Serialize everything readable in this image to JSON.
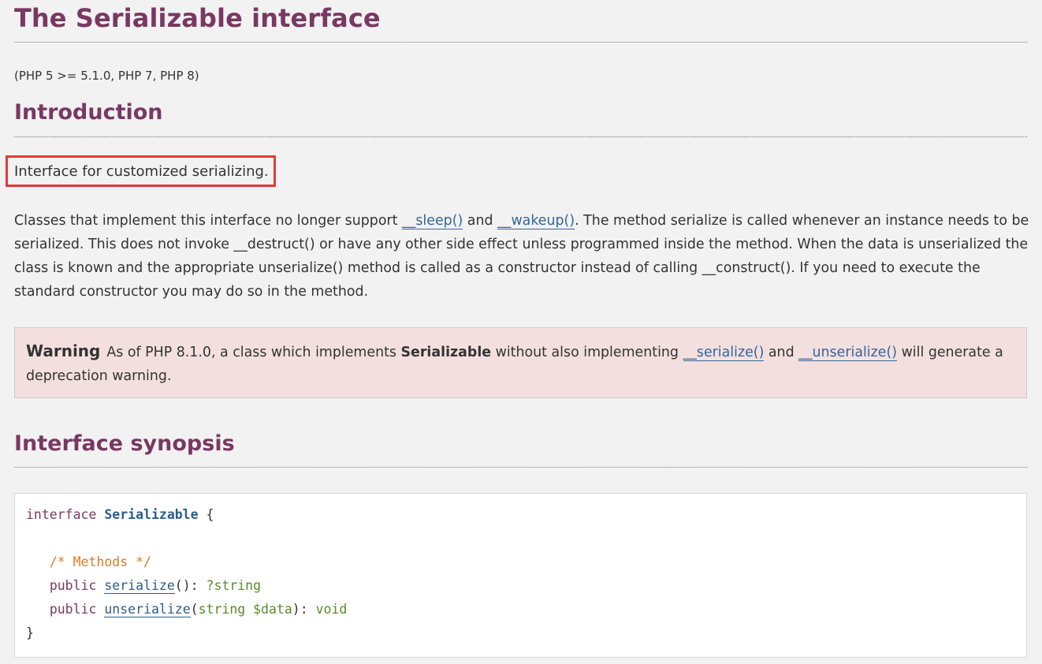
{
  "page": {
    "title": "The Serializable interface",
    "version": "(PHP 5 >= 5.1.0, PHP 7, PHP 8)"
  },
  "introduction": {
    "heading": "Introduction",
    "summary": "Interface for customized serializing.",
    "para_part1": "Classes that implement this interface no longer support ",
    "link_sleep": "__sleep()",
    "para_and": " and ",
    "link_wakeup": "__wakeup()",
    "para_part2": ". The method serialize is called whenever an instance needs to be serialized. This does not invoke __destruct() or have any other side effect unless programmed inside the method. When the data is unserialized the class is known and the appropriate unserialize() method is called as a constructor instead of calling __construct(). If you need to execute the standard constructor you may do so in the method."
  },
  "warning": {
    "title": "Warning",
    "text_part1": "As of PHP 8.1.0, a class which implements ",
    "bold": "Serializable",
    "text_part2": " without also implementing ",
    "link_serialize": "__serialize()",
    "text_and": " and ",
    "link_unserialize": "__unserialize()",
    "text_part3": " will generate a deprecation warning."
  },
  "synopsis": {
    "heading": "Interface synopsis",
    "kw_interface": "interface",
    "class_name": "Serializable",
    "open_brace": "{",
    "comment": "/* Methods */",
    "kw_public": "public",
    "method_serialize": "serialize",
    "serialize_sig": "(): ",
    "serialize_return": "?string",
    "method_unserialize": "unserialize",
    "unserialize_open": "(",
    "param_type": "string",
    "param_name": "$data",
    "unserialize_close": "): ",
    "unserialize_return": "void",
    "close_brace": "}"
  },
  "colors": {
    "heading": "#793862",
    "link": "#336699",
    "warning_bg": "#f4dfdf",
    "highlight_border": "#e53935"
  }
}
